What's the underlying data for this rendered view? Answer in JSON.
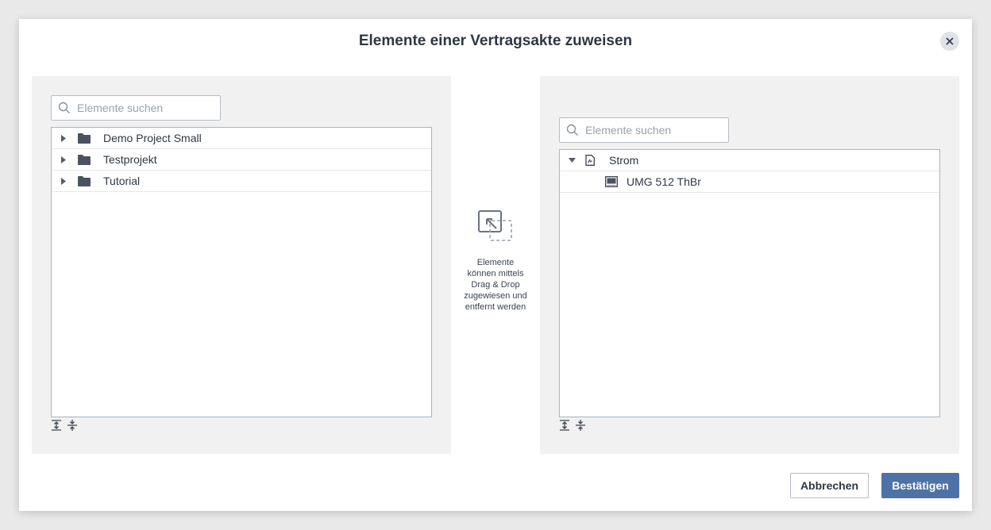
{
  "dialog": {
    "title": "Elemente einer Vertragsakte zuweisen",
    "close_icon": "close-icon"
  },
  "left_panel": {
    "search_placeholder": "Elemente suchen",
    "items": [
      {
        "label": "Demo Project Small",
        "icon": "folder-icon",
        "expanded": false
      },
      {
        "label": "Testprojekt",
        "icon": "folder-icon",
        "expanded": false
      },
      {
        "label": "Tutorial",
        "icon": "folder-icon",
        "expanded": false
      }
    ]
  },
  "middle": {
    "icon": "drag-drop-icon",
    "hint": "Elemente können mittels Drag & Drop zugewiesen und entfernt werden"
  },
  "right_panel": {
    "search_placeholder": "Elemente suchen",
    "items": [
      {
        "label": "Strom",
        "icon": "contract-document-icon",
        "expanded": true,
        "level": 0
      },
      {
        "label": "UMG 512 ThBr",
        "icon": "device-icon",
        "level": 1
      }
    ]
  },
  "footer": {
    "cancel_label": "Abbrechen",
    "confirm_label": "Bestätigen"
  },
  "colors": {
    "primary": "#4f72a6",
    "panel_bg": "#f1f1f1",
    "tree_border": "#a9b5c4"
  }
}
